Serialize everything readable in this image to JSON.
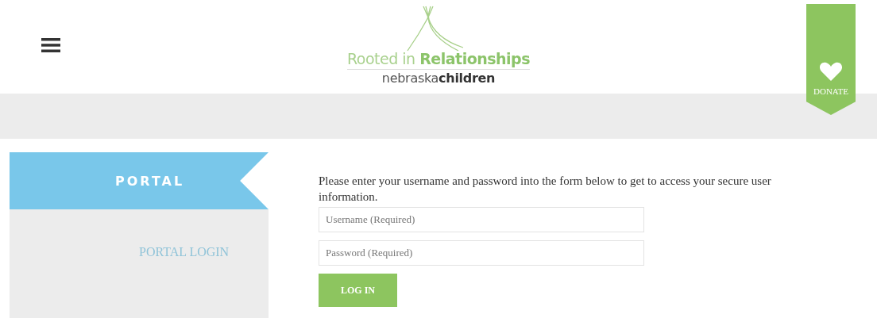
{
  "header": {
    "logo": {
      "tagline": "Rooted in **Relationships**",
      "name": "nebraska**children**"
    },
    "donate": {
      "label": "DONATE"
    }
  },
  "sidebar": {
    "title": "PORTAL",
    "items": [
      {
        "label": "PORTAL LOGIN"
      }
    ]
  },
  "form": {
    "intro": "Please enter your username and password into the form below to get to access your secure user information.",
    "fields": [
      {
        "placeholder": "Username (Required)"
      },
      {
        "placeholder": "Password (Required)"
      }
    ],
    "submit": "LOG IN"
  }
}
